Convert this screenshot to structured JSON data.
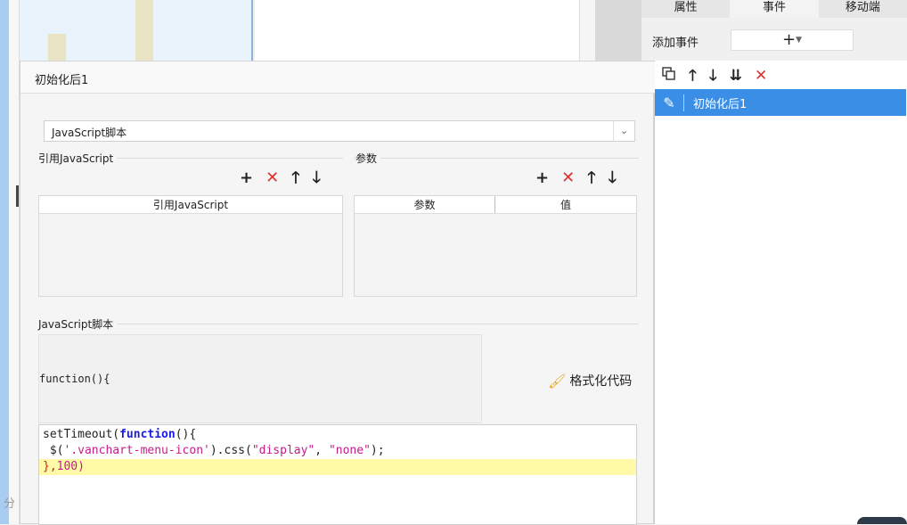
{
  "background": {
    "split_label": "分"
  },
  "right_panel": {
    "tabs": [
      "属性",
      "事件",
      "移动端"
    ],
    "add_event_label": "添加事件",
    "add_event_symbol": "+",
    "toolbar_icons": [
      "copy-icon",
      "arrow-up-icon",
      "arrow-down-icon",
      "sort-down-icon",
      "delete-icon"
    ],
    "events": [
      {
        "label": "初始化后1",
        "selected": true
      }
    ]
  },
  "dialog": {
    "title": "初始化后1",
    "type_select": {
      "value": "JavaScript脚本"
    },
    "reference_group": {
      "label": "引用JavaScript",
      "columns": [
        "引用JavaScript"
      ],
      "rows": []
    },
    "params_group": {
      "label": "参数",
      "columns": [
        "参数",
        "值"
      ],
      "rows": []
    },
    "script_group": {
      "label": "JavaScript脚本",
      "function_header": "function(){",
      "format_button": "格式化代码"
    },
    "code": {
      "line1_a": "setTimeout(",
      "line1_kw": "function",
      "line1_b": "(){",
      "line2_a": " $(",
      "line2_str1": "'.vanchart-menu-icon'",
      "line2_b": ").css(",
      "line2_str2": "\"display\"",
      "line2_c": ", ",
      "line2_str3": "\"none\"",
      "line2_d": ");",
      "line3_a": "},",
      "line3_b": "100)"
    }
  },
  "colors": {
    "accent_blue": "#3b8ee6",
    "delete_red": "#e03131",
    "highlight_line": "#fffaa8"
  }
}
